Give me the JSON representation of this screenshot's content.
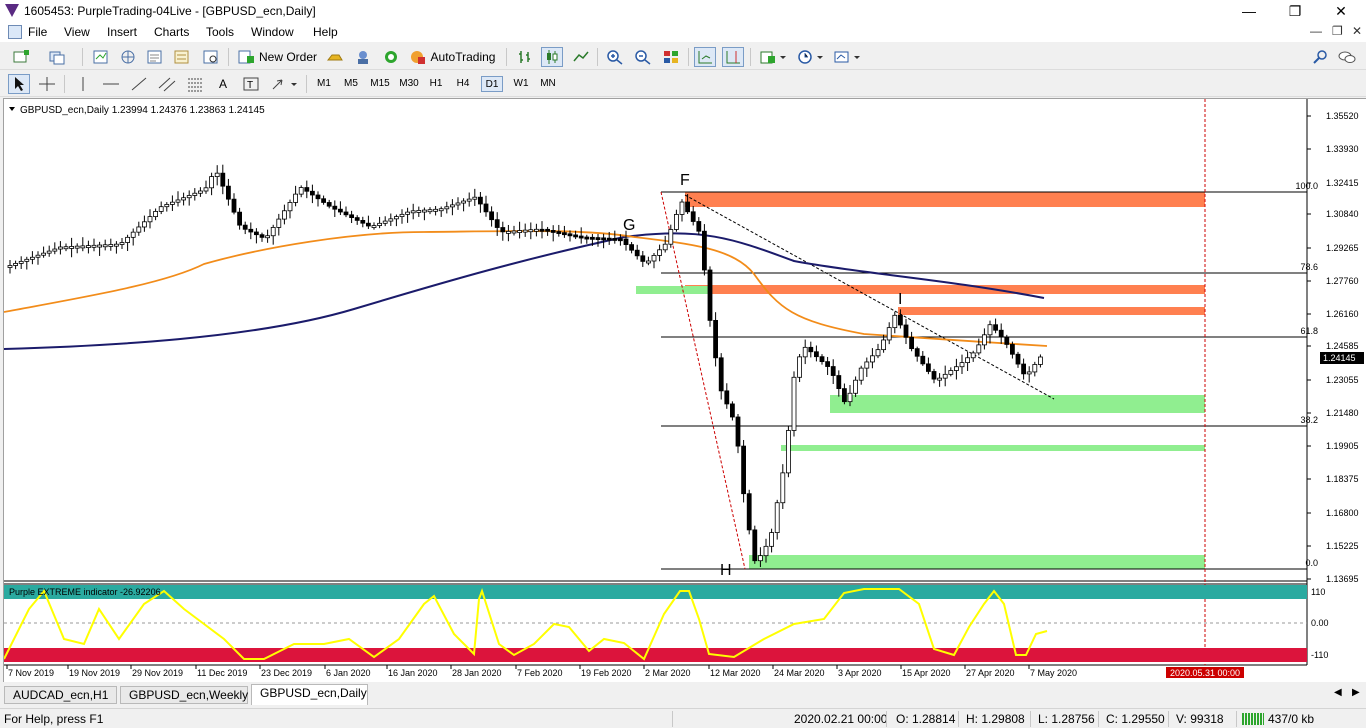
{
  "window": {
    "title": "1605453: PurpleTrading-04Live - [GBPUSD_ecn,Daily]"
  },
  "menu": [
    "File",
    "View",
    "Insert",
    "Charts",
    "Tools",
    "Window",
    "Help"
  ],
  "toolbar": {
    "new_order": "New Order",
    "autotrading": "AutoTrading"
  },
  "timeframes": [
    "M1",
    "M5",
    "M15",
    "M30",
    "H1",
    "H4",
    "D1",
    "W1",
    "MN"
  ],
  "active_timeframe": "D1",
  "chart": {
    "header": "GBPUSD_ecn,Daily  1.23994 1.24376 1.23863 1.24145",
    "price_ticks": [
      "1.35520",
      "1.33930",
      "1.32415",
      "1.30840",
      "1.29265",
      "1.27760",
      "1.26160",
      "1.24585",
      "1.23055",
      "1.21480",
      "1.19905",
      "1.18375",
      "1.16800",
      "1.15225",
      "1.13695"
    ],
    "current_price": "1.24145",
    "fib_labels": [
      "100.0",
      "78.6",
      "61.8",
      "38.2",
      "0.0"
    ],
    "wave_labels": [
      "F",
      "G",
      "I",
      "H"
    ],
    "date_ticks": [
      "7 Nov 2019",
      "19 Nov 2019",
      "29 Nov 2019",
      "11 Dec 2019",
      "23 Dec 2019",
      "6 Jan 2020",
      "16 Jan 2020",
      "28 Jan 2020",
      "7 Feb 2020",
      "19 Feb 2020",
      "2 Mar 2020",
      "12 Mar 2020",
      "24 Mar 2020",
      "3 Apr 2020",
      "15 Apr 2020",
      "27 Apr 2020",
      "7 May 2020"
    ],
    "future_date_label": "2020.05.31 00:00"
  },
  "indicator": {
    "label": "Purple EXTREME indicator -26.92206",
    "levels": [
      "110",
      "0.00",
      "-110"
    ]
  },
  "chart_tabs": [
    "AUDCAD_ecn,H1",
    "GBPUSD_ecn,Weekly",
    "GBPUSD_ecn,Daily"
  ],
  "active_tab": "GBPUSD_ecn,Daily",
  "status": {
    "help": "For Help, press F1",
    "datetime": "2020.02.21 00:00",
    "open": "O: 1.28814",
    "high": "H: 1.29808",
    "low": "L: 1.28756",
    "close": "C: 1.29550",
    "volume": "V: 99318",
    "traffic": "437/0 kb"
  },
  "colors": {
    "bull_candle": "#ffffff",
    "bear_candle": "#000000",
    "ma_orange": "#f28c1a",
    "ma_navy": "#1b1b6b",
    "resistance_zone": "#ff8050",
    "support_zone": "#90ee90",
    "osc_top_band": "#2aaaa0",
    "osc_bottom_band": "#dc143c",
    "osc_line": "#ffff00",
    "future_marker": "#cc0000"
  }
}
